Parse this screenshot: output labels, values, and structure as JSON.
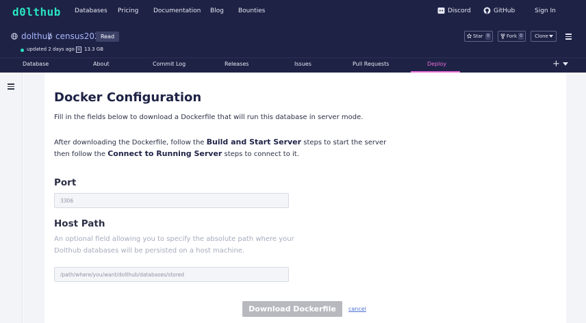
{
  "brand": {
    "logo": "d0lthub"
  },
  "topnav": {
    "links": [
      "Databases",
      "Pricing",
      "Documentation",
      "Blog",
      "Bounties"
    ],
    "discord": "Discord",
    "github": "GitHub",
    "signin": "Sign In"
  },
  "repo": {
    "owner": "dolthub",
    "separator": "/",
    "name": "census2020",
    "access_badge": "Read",
    "updated": "updated 2 days ago",
    "size": "13.3 GB",
    "star_label": "Star",
    "star_count": "0",
    "fork_label": "Fork",
    "fork_count": "0",
    "clone_label": "Clone"
  },
  "tabs": [
    "Database",
    "About",
    "Commit Log",
    "Releases",
    "Issues",
    "Pull Requests",
    "Deploy"
  ],
  "active_tab": "Deploy",
  "page": {
    "title": "Docker Configuration",
    "intro": "Fill in the fields below to download a Dockerfile that will run this database in server mode.",
    "after_1a": "After downloading the Dockerfile, follow the ",
    "after_1b": "Build and Start Server",
    "after_1c": " steps to start the server",
    "after_2a": "then follow the ",
    "after_2b": "Connect to Running Server",
    "after_2c": " steps to connect to it.",
    "port_heading": "Port",
    "port_placeholder": "3306",
    "host_heading": "Host Path",
    "host_hint_1": "An optional field allowing you to specify the absolute path where your",
    "host_hint_2": "Dolthub databases will be persisted on a host machine.",
    "host_placeholder": "/path/where/you/want/dolthub/databases/stored",
    "download_button": "Download Dockerfile",
    "cancel_link": "cancel"
  },
  "colors": {
    "nav_bg": "#1e2245",
    "logo": "#29e3c1",
    "link": "#a9b8ff",
    "active_tab": "#ea6fd9",
    "button_disabled": "#b8b9bf"
  },
  "icons": [
    "globe-icon",
    "database-size-icon",
    "discord-icon",
    "github-icon",
    "star-icon",
    "fork-icon",
    "chevron-down-icon",
    "hamburger-menu-icon",
    "plus-icon"
  ]
}
